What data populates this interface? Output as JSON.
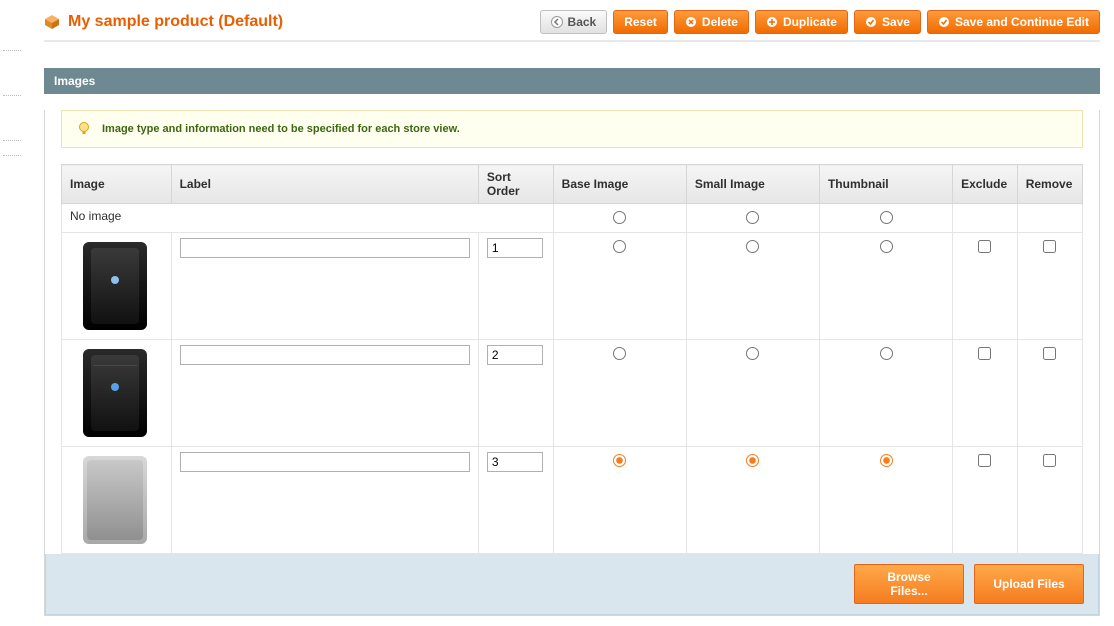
{
  "header": {
    "title": "My sample product (Default)",
    "buttons": {
      "back": "Back",
      "reset": "Reset",
      "delete": "Delete",
      "duplicate": "Duplicate",
      "save": "Save",
      "save_continue": "Save and Continue Edit"
    }
  },
  "section": {
    "title": "Images"
  },
  "notice": {
    "text": "Image type and information need to be specified for each store view."
  },
  "table": {
    "columns": {
      "image": "Image",
      "label": "Label",
      "sort_order": "Sort Order",
      "base_image": "Base Image",
      "small_image": "Small Image",
      "thumbnail": "Thumbnail",
      "exclude": "Exclude",
      "remove": "Remove"
    },
    "no_image_row": "No image",
    "rows": [
      {
        "label": "",
        "sort_order": "1",
        "base": false,
        "small": false,
        "thumb": false,
        "exclude": false,
        "remove": false
      },
      {
        "label": "",
        "sort_order": "2",
        "base": false,
        "small": false,
        "thumb": false,
        "exclude": false,
        "remove": false
      },
      {
        "label": "",
        "sort_order": "3",
        "base": true,
        "small": true,
        "thumb": true,
        "exclude": false,
        "remove": false
      }
    ]
  },
  "footer": {
    "browse": "Browse Files...",
    "upload": "Upload Files"
  }
}
